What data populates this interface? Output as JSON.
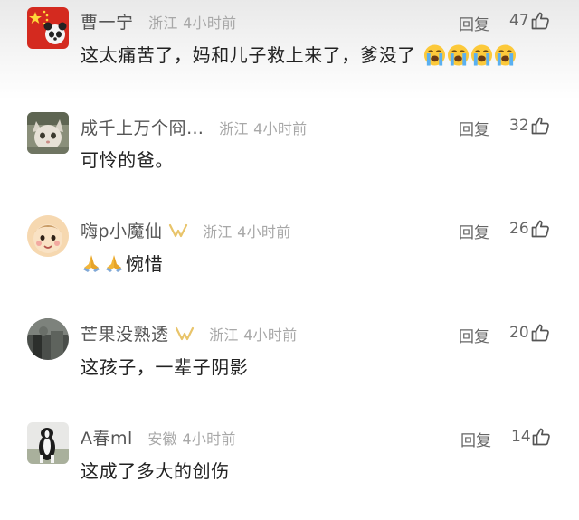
{
  "comments": [
    {
      "username": "曹一宁",
      "location": "浙江",
      "time": "4小时前",
      "reply_label": "回复",
      "likes": "47",
      "text": "这太痛苦了，妈和儿子救上来了，爹没了",
      "trailing_emoji_icon": "loudly-crying-face-icon",
      "trailing_emoji_count": 4,
      "avatar_icon": "flag-panda-avatar"
    },
    {
      "username": "成千上万个冏…",
      "location": "浙江",
      "time": "4小时前",
      "reply_label": "回复",
      "likes": "32",
      "text": "可怜的爸。",
      "avatar_icon": "cat-avatar"
    },
    {
      "username": "嗨p小魔仙",
      "vip_icon": "vip-ribbon-icon",
      "location": "浙江",
      "time": "4小时前",
      "reply_label": "回复",
      "likes": "26",
      "leading_emoji_icon": "folded-hands-icon",
      "leading_emoji_count": 2,
      "text": "惋惜",
      "avatar_icon": "baby-avatar"
    },
    {
      "username": "芒果没熟透",
      "vip_icon": "vip-ribbon-icon",
      "location": "浙江",
      "time": "4小时前",
      "reply_label": "回复",
      "likes": "20",
      "text": "这孩子，一辈子阴影",
      "avatar_icon": "dark-photo-avatar"
    },
    {
      "username": "A春ml",
      "location": "安徽",
      "time": "4小时前",
      "reply_label": "回复",
      "likes": "14",
      "text": "这成了多大的创伤",
      "avatar_icon": "dog-avatar"
    }
  ],
  "colors": {
    "username": "#555555",
    "meta": "#a8a8a8",
    "text": "#222222",
    "vip": "#e8c46a"
  }
}
